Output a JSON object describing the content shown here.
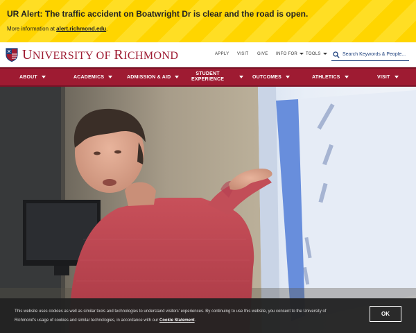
{
  "alert": {
    "title": "UR Alert: The traffic accident on Boatwright Dr is clear and the road is open.",
    "info_prefix": "More information at",
    "link_text": "alert.richmond.edu",
    "info_suffix": "."
  },
  "header": {
    "logo_text_first": "University of ",
    "logo_text_second": "Richmond",
    "utility_links": [
      "APPLY",
      "VISIT",
      "GIVE",
      "INFO FOR",
      "TOOLS"
    ],
    "search_placeholder": "Search Keywords & People..."
  },
  "nav": {
    "items": [
      "ABOUT",
      "ACADEMICS",
      "ADMISSION & AID",
      "STUDENT",
      "EXPERIENCE",
      "OUTCOMES",
      "ATHLETICS",
      "VISIT"
    ]
  },
  "cookie": {
    "text_before": "This website uses cookies as well as similar tools and technologies to understand visitors' experiences. By continuing to use this website, you consent to the University of Richmond's usage of cookies and similar technologies, in accordance with our",
    "link_text": "Cookie Statement",
    "text_after": ".",
    "ok_label": "OK"
  },
  "colors": {
    "brand_red": "#9e1b32",
    "alert_yellow": "#ffd500",
    "brand_blue": "#1c3f7c"
  },
  "icons": {
    "search": "search-icon",
    "shield": "shield-icon",
    "caret": "caret-down-icon"
  }
}
